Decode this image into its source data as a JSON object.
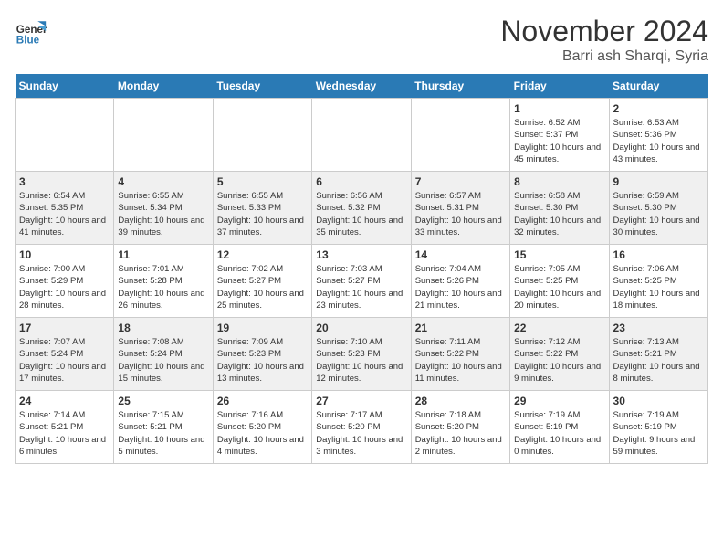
{
  "logo": {
    "line1": "General",
    "line2": "Blue"
  },
  "title": "November 2024",
  "location": "Barri ash Sharqi, Syria",
  "days_of_week": [
    "Sunday",
    "Monday",
    "Tuesday",
    "Wednesday",
    "Thursday",
    "Friday",
    "Saturday"
  ],
  "weeks": [
    [
      {
        "day": "",
        "info": ""
      },
      {
        "day": "",
        "info": ""
      },
      {
        "day": "",
        "info": ""
      },
      {
        "day": "",
        "info": ""
      },
      {
        "day": "",
        "info": ""
      },
      {
        "day": "1",
        "info": "Sunrise: 6:52 AM\nSunset: 5:37 PM\nDaylight: 10 hours and 45 minutes."
      },
      {
        "day": "2",
        "info": "Sunrise: 6:53 AM\nSunset: 5:36 PM\nDaylight: 10 hours and 43 minutes."
      }
    ],
    [
      {
        "day": "3",
        "info": "Sunrise: 6:54 AM\nSunset: 5:35 PM\nDaylight: 10 hours and 41 minutes."
      },
      {
        "day": "4",
        "info": "Sunrise: 6:55 AM\nSunset: 5:34 PM\nDaylight: 10 hours and 39 minutes."
      },
      {
        "day": "5",
        "info": "Sunrise: 6:55 AM\nSunset: 5:33 PM\nDaylight: 10 hours and 37 minutes."
      },
      {
        "day": "6",
        "info": "Sunrise: 6:56 AM\nSunset: 5:32 PM\nDaylight: 10 hours and 35 minutes."
      },
      {
        "day": "7",
        "info": "Sunrise: 6:57 AM\nSunset: 5:31 PM\nDaylight: 10 hours and 33 minutes."
      },
      {
        "day": "8",
        "info": "Sunrise: 6:58 AM\nSunset: 5:30 PM\nDaylight: 10 hours and 32 minutes."
      },
      {
        "day": "9",
        "info": "Sunrise: 6:59 AM\nSunset: 5:30 PM\nDaylight: 10 hours and 30 minutes."
      }
    ],
    [
      {
        "day": "10",
        "info": "Sunrise: 7:00 AM\nSunset: 5:29 PM\nDaylight: 10 hours and 28 minutes."
      },
      {
        "day": "11",
        "info": "Sunrise: 7:01 AM\nSunset: 5:28 PM\nDaylight: 10 hours and 26 minutes."
      },
      {
        "day": "12",
        "info": "Sunrise: 7:02 AM\nSunset: 5:27 PM\nDaylight: 10 hours and 25 minutes."
      },
      {
        "day": "13",
        "info": "Sunrise: 7:03 AM\nSunset: 5:27 PM\nDaylight: 10 hours and 23 minutes."
      },
      {
        "day": "14",
        "info": "Sunrise: 7:04 AM\nSunset: 5:26 PM\nDaylight: 10 hours and 21 minutes."
      },
      {
        "day": "15",
        "info": "Sunrise: 7:05 AM\nSunset: 5:25 PM\nDaylight: 10 hours and 20 minutes."
      },
      {
        "day": "16",
        "info": "Sunrise: 7:06 AM\nSunset: 5:25 PM\nDaylight: 10 hours and 18 minutes."
      }
    ],
    [
      {
        "day": "17",
        "info": "Sunrise: 7:07 AM\nSunset: 5:24 PM\nDaylight: 10 hours and 17 minutes."
      },
      {
        "day": "18",
        "info": "Sunrise: 7:08 AM\nSunset: 5:24 PM\nDaylight: 10 hours and 15 minutes."
      },
      {
        "day": "19",
        "info": "Sunrise: 7:09 AM\nSunset: 5:23 PM\nDaylight: 10 hours and 13 minutes."
      },
      {
        "day": "20",
        "info": "Sunrise: 7:10 AM\nSunset: 5:23 PM\nDaylight: 10 hours and 12 minutes."
      },
      {
        "day": "21",
        "info": "Sunrise: 7:11 AM\nSunset: 5:22 PM\nDaylight: 10 hours and 11 minutes."
      },
      {
        "day": "22",
        "info": "Sunrise: 7:12 AM\nSunset: 5:22 PM\nDaylight: 10 hours and 9 minutes."
      },
      {
        "day": "23",
        "info": "Sunrise: 7:13 AM\nSunset: 5:21 PM\nDaylight: 10 hours and 8 minutes."
      }
    ],
    [
      {
        "day": "24",
        "info": "Sunrise: 7:14 AM\nSunset: 5:21 PM\nDaylight: 10 hours and 6 minutes."
      },
      {
        "day": "25",
        "info": "Sunrise: 7:15 AM\nSunset: 5:21 PM\nDaylight: 10 hours and 5 minutes."
      },
      {
        "day": "26",
        "info": "Sunrise: 7:16 AM\nSunset: 5:20 PM\nDaylight: 10 hours and 4 minutes."
      },
      {
        "day": "27",
        "info": "Sunrise: 7:17 AM\nSunset: 5:20 PM\nDaylight: 10 hours and 3 minutes."
      },
      {
        "day": "28",
        "info": "Sunrise: 7:18 AM\nSunset: 5:20 PM\nDaylight: 10 hours and 2 minutes."
      },
      {
        "day": "29",
        "info": "Sunrise: 7:19 AM\nSunset: 5:19 PM\nDaylight: 10 hours and 0 minutes."
      },
      {
        "day": "30",
        "info": "Sunrise: 7:19 AM\nSunset: 5:19 PM\nDaylight: 9 hours and 59 minutes."
      }
    ]
  ]
}
